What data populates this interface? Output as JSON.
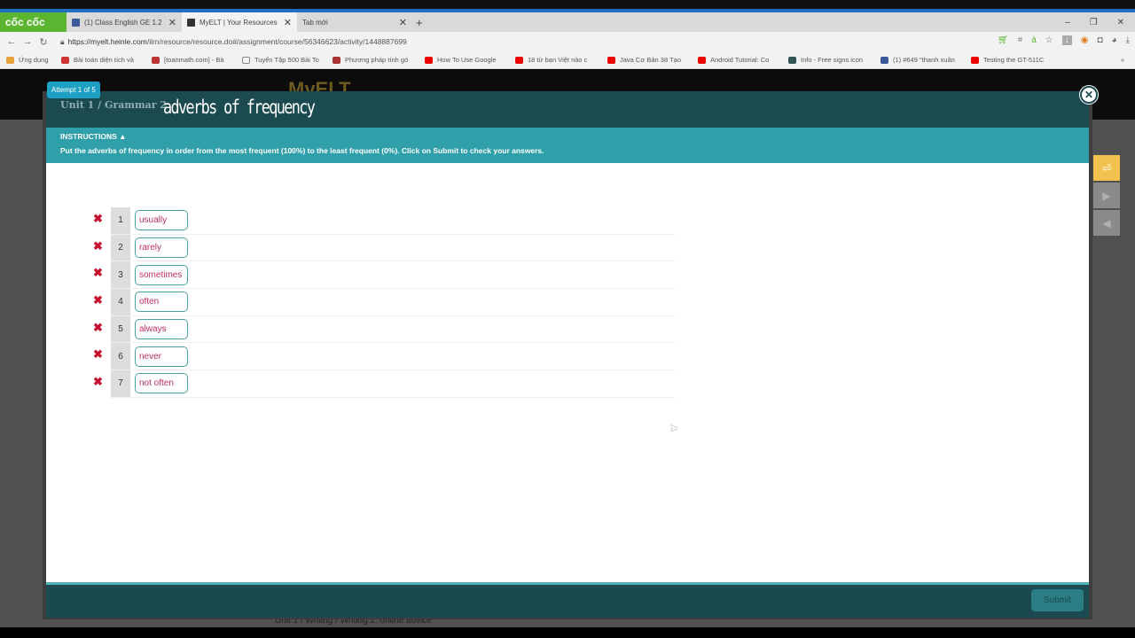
{
  "browser": {
    "brand": "cốc cốc",
    "tabs": [
      {
        "label": "(1) Class English GE 1.2",
        "active": false
      },
      {
        "label": "MyELT | Your Resources",
        "active": true
      },
      {
        "label": "Tab mới",
        "active": false
      }
    ],
    "url_host": "https://myelt.heinle.com",
    "url_path": "/ilrn/resource/resource.do#/assignment/course/56346623/activity/1448887699",
    "bookmarks": [
      "Ứng dụng",
      "Bài toán diện tích và",
      "[toanmath.com] - Bà",
      "Tuyển Tập 500 Bài To",
      "Phương pháp tính gó",
      "How To Use Google",
      "18 từ bạn Việt nào c",
      "Java Cơ Bản 38 Tạo",
      "Android Tutorial: Co",
      "Info - Free signs icon",
      "(1) #649 \"thanh xuân",
      "Testing the GT-511C"
    ]
  },
  "page": {
    "logo": "MyELT",
    "bottom_crumb": "Unit 1 / Writing / Writing 2: online advice"
  },
  "modal": {
    "attempt": "Attempt 1 of 5",
    "crumb": "Unit 1 / Grammar 2",
    "title": "adverbs of frequency",
    "instructions_heading": "INSTRUCTIONS ▲",
    "instructions": "Put the adverbs of frequency in order from the most frequent (100%) to the least frequent (0%). Click on Submit to check your answers.",
    "items": [
      {
        "n": "1",
        "word": "usually",
        "correct": false
      },
      {
        "n": "2",
        "word": "rarely",
        "correct": false
      },
      {
        "n": "3",
        "word": "sometimes",
        "correct": false
      },
      {
        "n": "4",
        "word": "often",
        "correct": false
      },
      {
        "n": "5",
        "word": "always",
        "correct": false
      },
      {
        "n": "6",
        "word": "never",
        "correct": false
      },
      {
        "n": "7",
        "word": "not often",
        "correct": false
      }
    ],
    "submit": "Submit"
  },
  "colors": {
    "header": "#1b4a50",
    "instructions": "#2f9fa9",
    "wrong": "#c8102e",
    "word": "#c0305a"
  }
}
